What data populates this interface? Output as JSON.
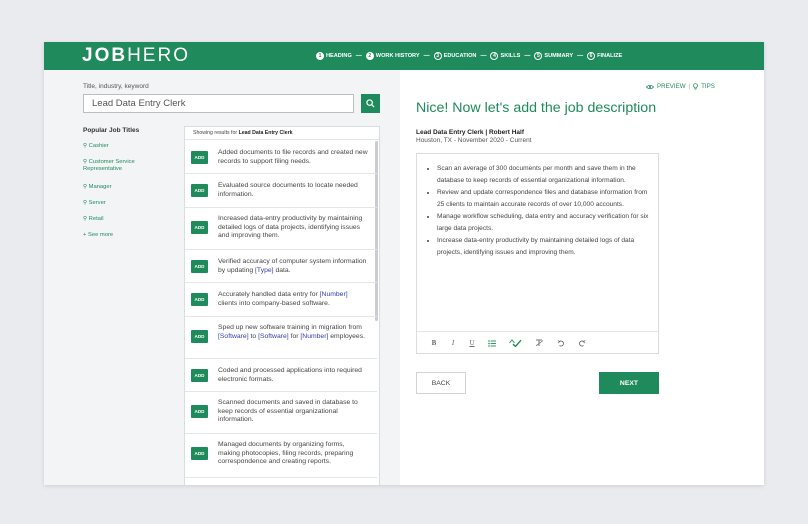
{
  "brand": {
    "logo_bold": "JOB",
    "logo_light": "HERO"
  },
  "steps": [
    {
      "num": "1",
      "label": "HEADING"
    },
    {
      "num": "2",
      "label": "WORK HISTORY"
    },
    {
      "num": "3",
      "label": "EDUCATION"
    },
    {
      "num": "4",
      "label": "SKILLS"
    },
    {
      "num": "5",
      "label": "SUMMARY"
    },
    {
      "num": "6",
      "label": "FINALIZE"
    }
  ],
  "search": {
    "label": "Title, industry, keyword",
    "value": "Lead Data Entry Clerk"
  },
  "popular": {
    "title": "Popular Job Titles",
    "items": [
      "Cashier",
      "Customer Service Representative",
      "Manager",
      "Server",
      "Retail"
    ],
    "see_more": "+ See more"
  },
  "results": {
    "head_prefix": "Showing results for",
    "head_term": "Lead Data Entry Clerk",
    "add_label": "ADD",
    "items": [
      "Added documents to file records and created new records to support filing needs.",
      "Evaluated source documents to locate needed information.",
      "Increased data-entry productivity by maintaining detailed logs of data projects, identifying issues and improving them.",
      "Verified accuracy of computer system information by updating [Type] data.",
      "Accurately handled data entry for [Number] clients into company-based software.",
      "Sped up new software training in migration from [Software] to [Software] for [Number] employees.",
      "Coded and processed applications into required electronic formats.",
      "Scanned documents and saved in database to keep records of essential organizational information.",
      "Managed documents by organizing forms, making photocopies, filing records, preparing correspondence and creating reports."
    ]
  },
  "right": {
    "preview": "PREVIEW",
    "divider": "|",
    "tips": "TIPS",
    "heading": "Nice! Now let's add the job description",
    "job_title": "Lead Data Entry Clerk | Robert Half",
    "job_sub": "Houston, TX - November 2020 - Current",
    "bullets": [
      "Scan an average of 300 documents per month and save them in the database to keep records of essential organizational information.",
      "Review and update correspondence files and database information from 25 clients to maintain accurate records of over 10,000 accounts.",
      "Manage workflow scheduling, data entry and accuracy verification for six large data projects.",
      "Increase data-entry productivity by maintaining detailed logs of data projects, identifying issues and improving them."
    ],
    "toolbar": {
      "bold": "B",
      "italic": "I",
      "underline": "U"
    },
    "back": "BACK",
    "next": "NEXT"
  },
  "colors": {
    "brand_green": "#1f8a5b",
    "placeholder_blue": "#2f3ea8"
  },
  "icons": [
    "search-icon",
    "eye-icon",
    "lightbulb-icon",
    "list-icon",
    "spellcheck-icon",
    "clear-format-icon",
    "undo-icon",
    "redo-icon"
  ]
}
